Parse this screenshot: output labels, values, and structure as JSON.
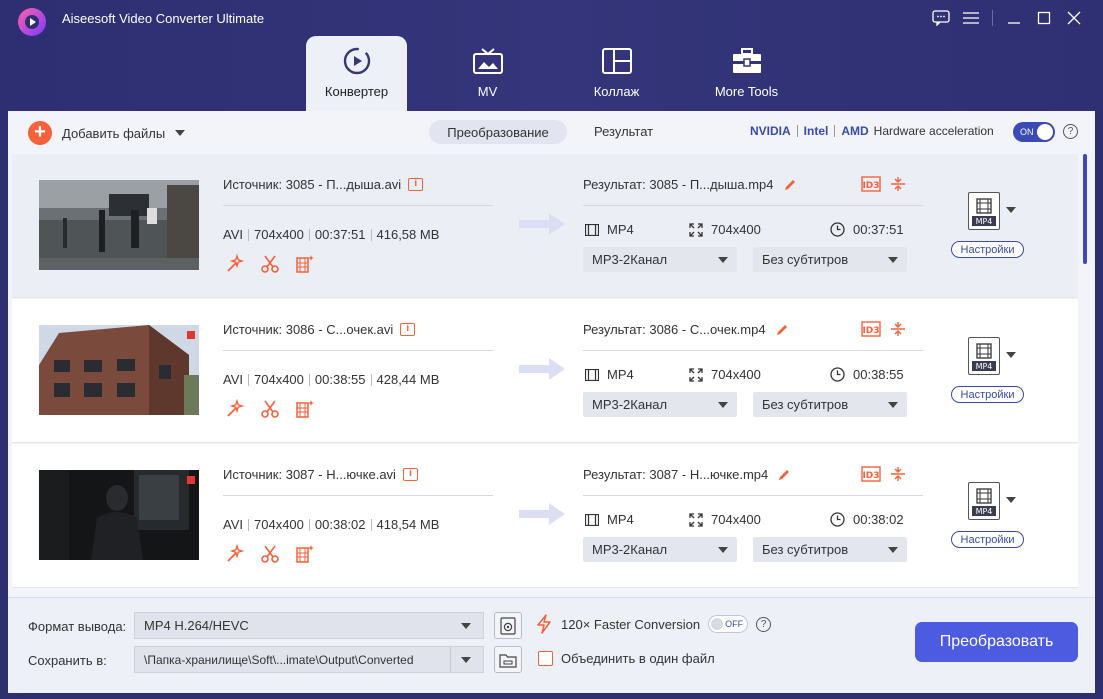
{
  "app": {
    "title": "Aiseesoft Video Converter Ultimate"
  },
  "tabs": [
    {
      "label": "Конвертер",
      "icon": "converter-icon",
      "active": true
    },
    {
      "label": "MV",
      "icon": "tv-icon",
      "active": false
    },
    {
      "label": "Коллаж",
      "icon": "collage-icon",
      "active": false
    },
    {
      "label": "More Tools",
      "icon": "toolbox-icon",
      "active": false
    }
  ],
  "toolbar": {
    "add_files": "Добавить файлы",
    "conversion_tab": "Преобразование",
    "result_tab": "Результат",
    "hw": {
      "nvidia": "NVIDIA",
      "intel": "Intel",
      "amd": "AMD",
      "label": "Hardware acceleration",
      "toggle": "ON"
    },
    "help": "?"
  },
  "files": [
    {
      "source": "Источник: 3085 - П...дыша.avi",
      "format": "AVI",
      "resolution": "704x400",
      "duration": "00:37:51",
      "size": "416,58 MB",
      "result": "Результат: 3085 - П...дыша.mp4",
      "out_format": "MP4",
      "out_resolution": "704x400",
      "out_duration": "00:37:51",
      "audio": "MP3-2Канал",
      "subtitles": "Без субтитров",
      "settings": "Настройки",
      "badge": "MP4"
    },
    {
      "source": "Источник: 3086 - С...очек.avi",
      "format": "AVI",
      "resolution": "704x400",
      "duration": "00:38:55",
      "size": "428,44 MB",
      "result": "Результат: 3086 - С...очек.mp4",
      "out_format": "MP4",
      "out_resolution": "704x400",
      "out_duration": "00:38:55",
      "audio": "MP3-2Канал",
      "subtitles": "Без субтитров",
      "settings": "Настройки",
      "badge": "MP4"
    },
    {
      "source": "Источник: 3087 - Н...ючке.avi",
      "format": "AVI",
      "resolution": "704x400",
      "duration": "00:38:02",
      "size": "418,54 MB",
      "result": "Результат: 3087 - Н...ючке.mp4",
      "out_format": "MP4",
      "out_resolution": "704x400",
      "out_duration": "00:38:02",
      "audio": "MP3-2Канал",
      "subtitles": "Без субтитров",
      "settings": "Настройки",
      "badge": "MP4"
    }
  ],
  "bottom": {
    "format_label": "Формат вывода:",
    "format_value": "MP4 H.264/HEVC",
    "save_label": "Сохранить в:",
    "save_path": "\\Папка-хранилище\\Soft\\...imate\\Output\\Converted",
    "faster": "120× Faster Conversion",
    "faster_toggle": "OFF",
    "help": "?",
    "merge": "Объединить в один файл",
    "convert": "Преобразовать"
  },
  "colors": {
    "accent": "#4c5be0",
    "orange": "#f4613a",
    "titlebar": "#2e2f6e"
  }
}
